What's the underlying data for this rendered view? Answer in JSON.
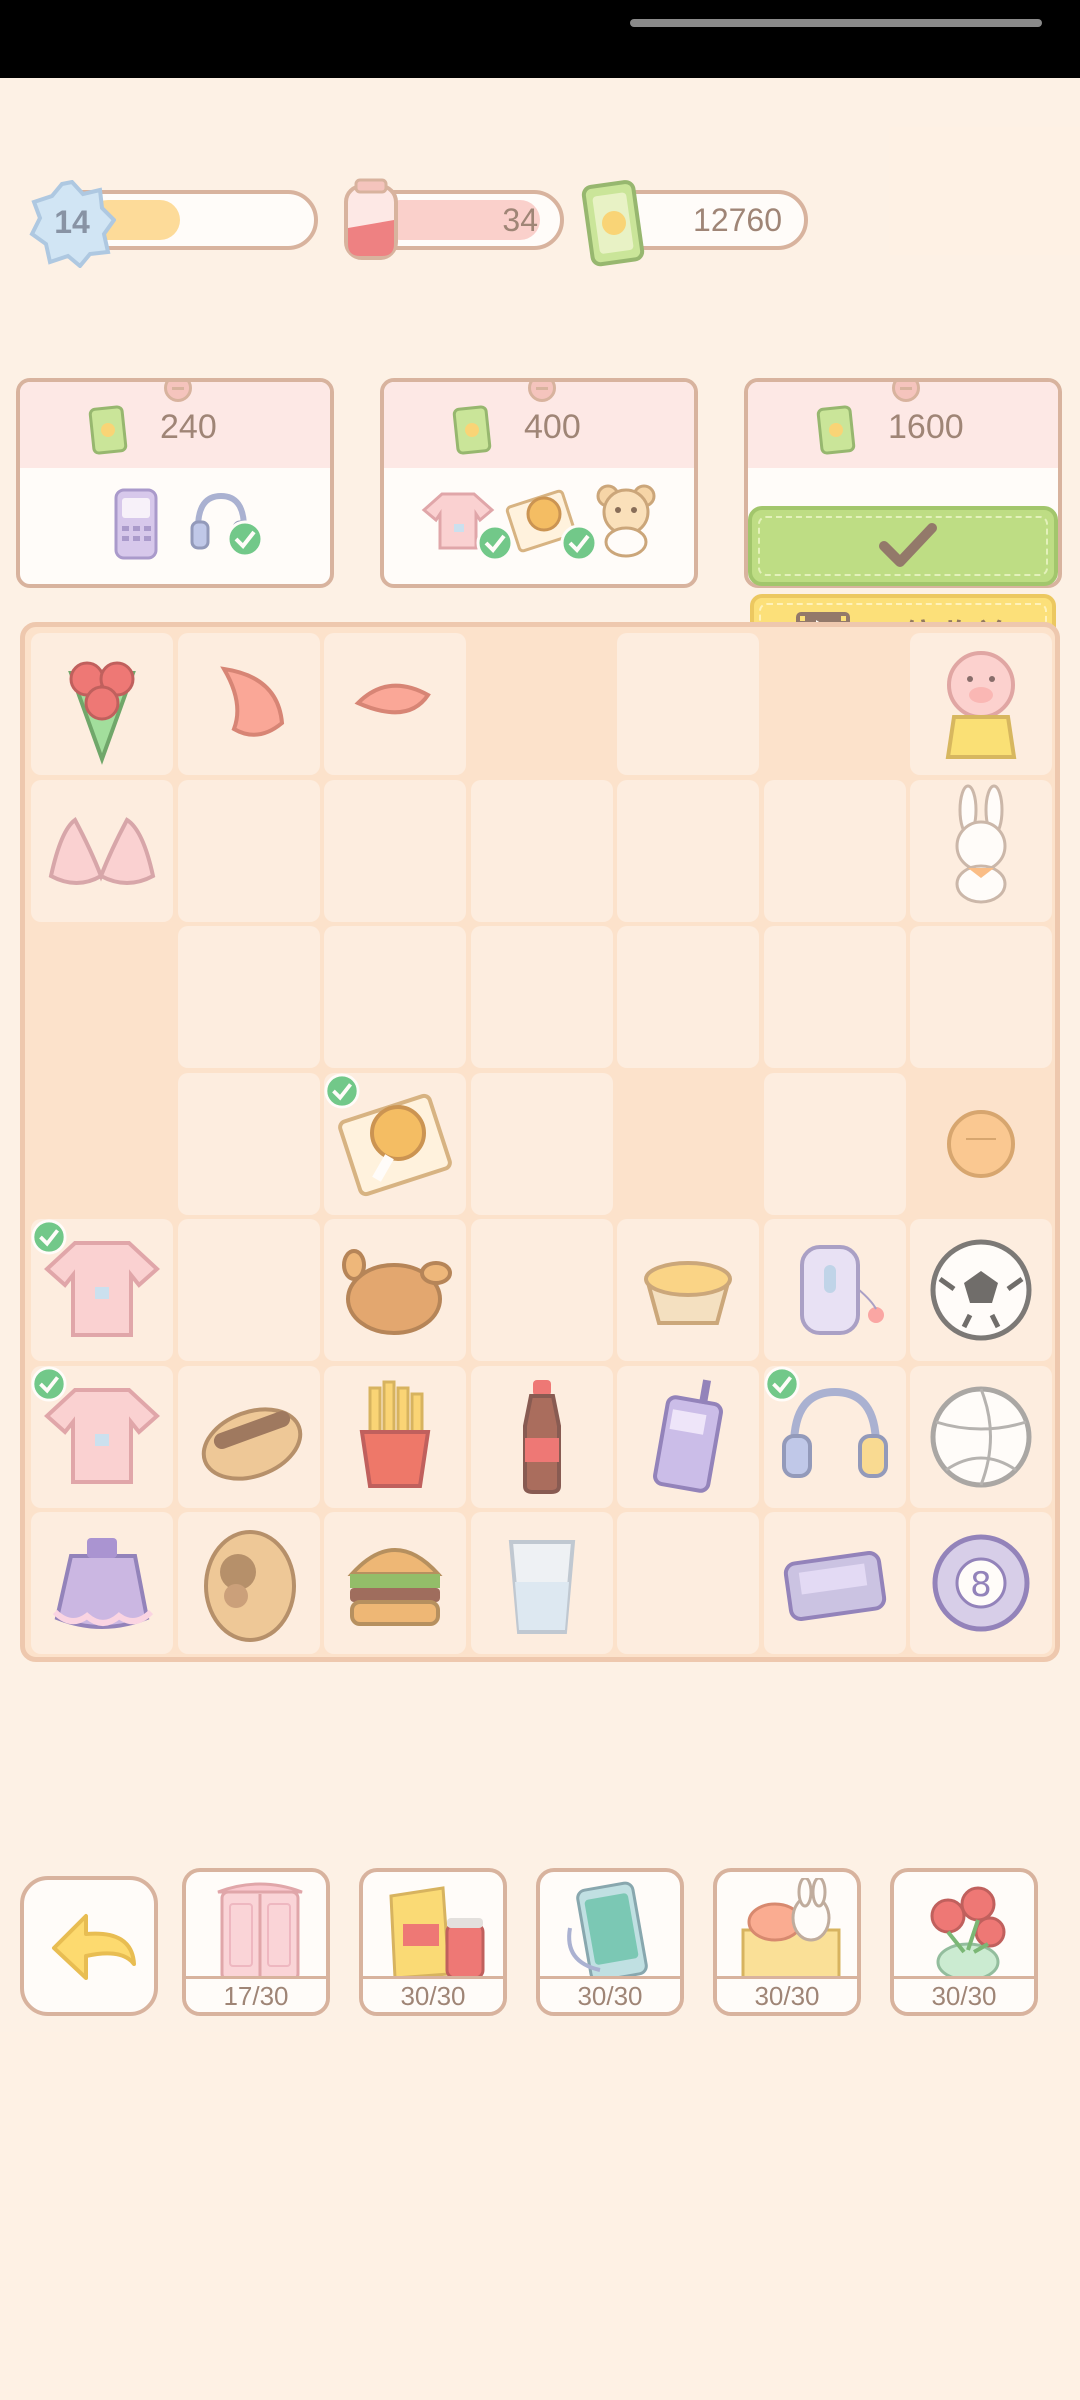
{
  "hud": {
    "level": "14",
    "level_progress": 0.42,
    "energy": "34",
    "cash": "12760"
  },
  "orders": [
    {
      "reward": "240",
      "items": [
        "phone-icon",
        "headphones-icon"
      ]
    },
    {
      "reward": "400",
      "items": [
        "pink-shirt-icon",
        "fried-chicken-icon",
        "teddy-bear-icon"
      ]
    },
    {
      "reward": "1600",
      "items": []
    }
  ],
  "triple_reward_label": "三倍收益",
  "board": {
    "rows": [
      [
        "rose-bouquet-icon",
        "petal-icon",
        "petal-small-icon",
        "",
        "",
        "",
        "pig-plush-icon"
      ],
      [
        "bra-icon",
        "",
        "",
        "",
        "",
        "",
        "bunny-plush-icon"
      ],
      [
        "",
        "",
        "",
        "",
        "",
        "",
        ""
      ],
      [
        "",
        "",
        "fried-chicken-icon",
        "",
        "",
        "",
        "ping-pong-ball-icon"
      ],
      [
        "pink-shirt-icon",
        "",
        "roast-chicken-icon",
        "",
        "egg-tart-icon",
        "flip-phone-icon",
        "soccer-ball-icon"
      ],
      [
        "pink-shirt-icon",
        "sandals-icon",
        "french-fries-icon",
        "cola-bottle-icon",
        "cordless-phone-icon",
        "headphones-icon",
        "volleyball-icon"
      ],
      [
        "purple-dress-icon",
        "slipper-icon",
        "burger-icon",
        "water-glass-icon",
        "",
        "pager-icon",
        "eight-ball-icon"
      ]
    ]
  },
  "categories": [
    {
      "icon": "wardrobe-icon",
      "count": "17/30"
    },
    {
      "icon": "snacks-icon",
      "count": "30/30"
    },
    {
      "icon": "smartphone-icon",
      "count": "30/30"
    },
    {
      "icon": "gift-box-icon",
      "count": "30/30"
    },
    {
      "icon": "flower-pot-icon",
      "count": "30/30"
    }
  ],
  "colors": {
    "background": "#fdf0e3",
    "accent_green": "#a5d45d",
    "accent_yellow": "#fbd84e",
    "border_brown": "#c99a82"
  }
}
